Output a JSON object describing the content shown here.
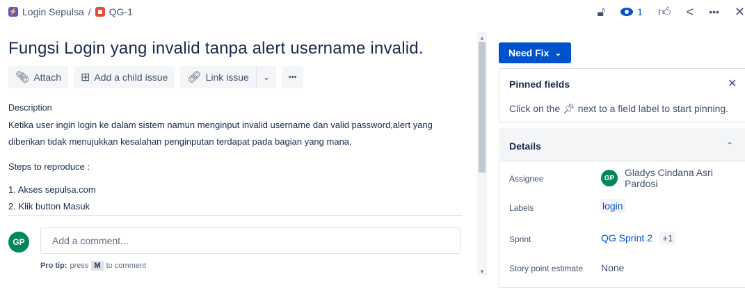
{
  "breadcrumb": {
    "project": "Login Sepulsa",
    "separator": "/",
    "issue_key": "QG-1"
  },
  "topbar": {
    "watch_count": "1",
    "lock_icon": "lock-icon",
    "watch_icon": "eye-icon",
    "like_icon": "thumbs-up-icon",
    "share_icon": "share-icon",
    "more_icon": "more-icon",
    "close_icon": "close-icon"
  },
  "issue": {
    "title": "Fungsi Login yang invalid tanpa alert username invalid.",
    "description_heading": "Description",
    "description_text": "Ketika user ingin login ke dalam sistem namun menginput invalid username dan valid password,alert yang diberikan tidak menujukkan kesalahan penginputan terdapat pada bagian yang mana.",
    "steps_heading": "Steps to reproduce :",
    "steps": [
      "1. Akses sepulsa.com",
      "2. Klik button Masuk"
    ]
  },
  "actions": {
    "attach": "Attach",
    "child": "Add a child issue",
    "link": "Link issue",
    "more": "•••"
  },
  "comment": {
    "avatar": "GP",
    "placeholder": "Add a comment...",
    "protip_label": "Pro tip:",
    "protip_pre": "press",
    "protip_key": "M",
    "protip_post": "to comment"
  },
  "sidebar": {
    "status": "Need Fix",
    "pinned_title": "Pinned fields",
    "pinned_pre": "Click on the",
    "pinned_post": "next to a field label to start pinning.",
    "details_title": "Details",
    "fields": {
      "assignee_label": "Assignee",
      "assignee_avatar": "GP",
      "assignee_value": "Gladys Cindana Asri Pardosi",
      "labels_label": "Labels",
      "labels_value": "login",
      "sprint_label": "Sprint",
      "sprint_value": "QG Sprint 2",
      "sprint_more": "+1",
      "story_label": "Story point estimate",
      "story_value": "None"
    }
  },
  "colors": {
    "primary": "#0052cc",
    "text": "#172b4d",
    "subtle": "#42526e",
    "avatar_green": "#00875a"
  }
}
